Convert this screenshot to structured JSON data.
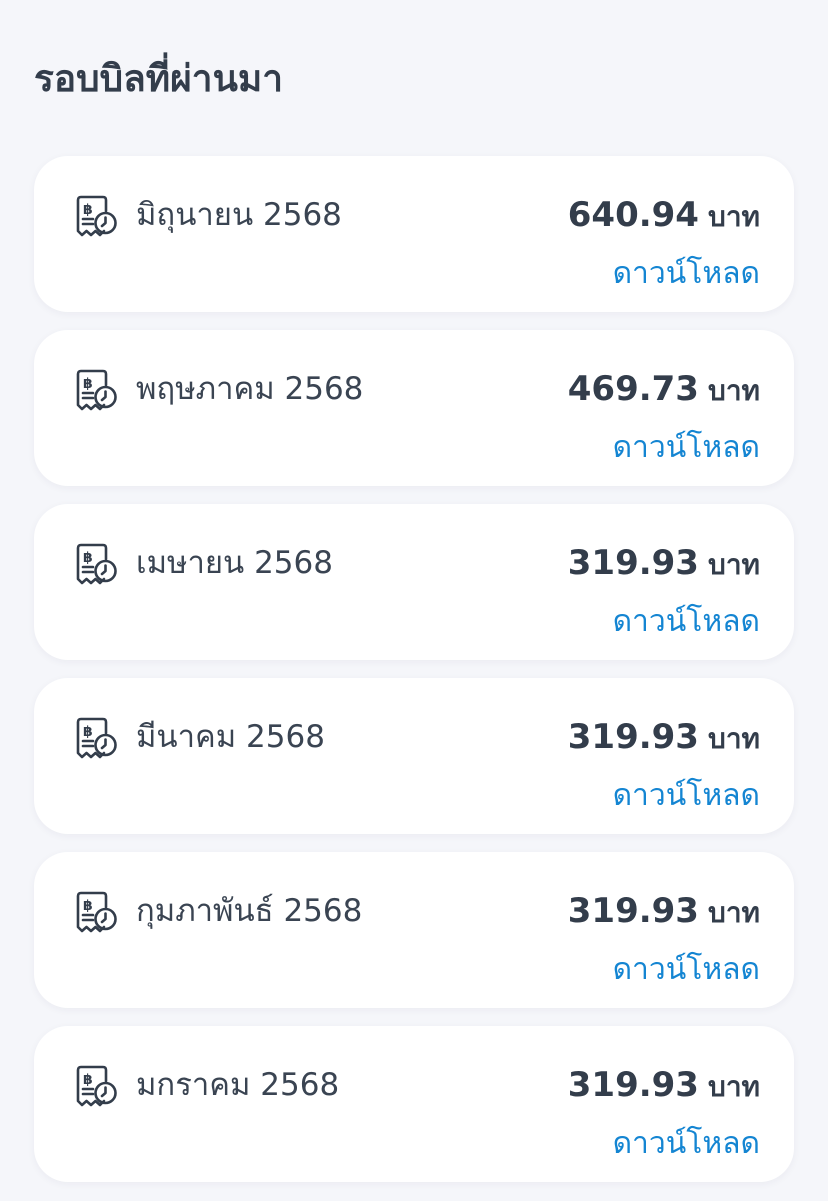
{
  "header": {
    "title": "รอบบิลที่ผ่านมา"
  },
  "bills": [
    {
      "month": "มิถุนายน 2568",
      "amount": "640.94",
      "currency": "บาท",
      "download_label": "ดาวน์โหลด"
    },
    {
      "month": "พฤษภาคม 2568",
      "amount": "469.73",
      "currency": "บาท",
      "download_label": "ดาวน์โหลด"
    },
    {
      "month": "เมษายน 2568",
      "amount": "319.93",
      "currency": "บาท",
      "download_label": "ดาวน์โหลด"
    },
    {
      "month": "มีนาคม 2568",
      "amount": "319.93",
      "currency": "บาท",
      "download_label": "ดาวน์โหลด"
    },
    {
      "month": "กุมภาพันธ์ 2568",
      "amount": "319.93",
      "currency": "บาท",
      "download_label": "ดาวน์โหลด"
    },
    {
      "month": "มกราคม 2568",
      "amount": "319.93",
      "currency": "บาท",
      "download_label": "ดาวน์โหลด"
    }
  ],
  "icons": {
    "bill": "receipt-baht-clock-icon"
  },
  "colors": {
    "background": "#f5f6fa",
    "card": "#ffffff",
    "text": "#333d4b",
    "link": "#1485d2"
  }
}
